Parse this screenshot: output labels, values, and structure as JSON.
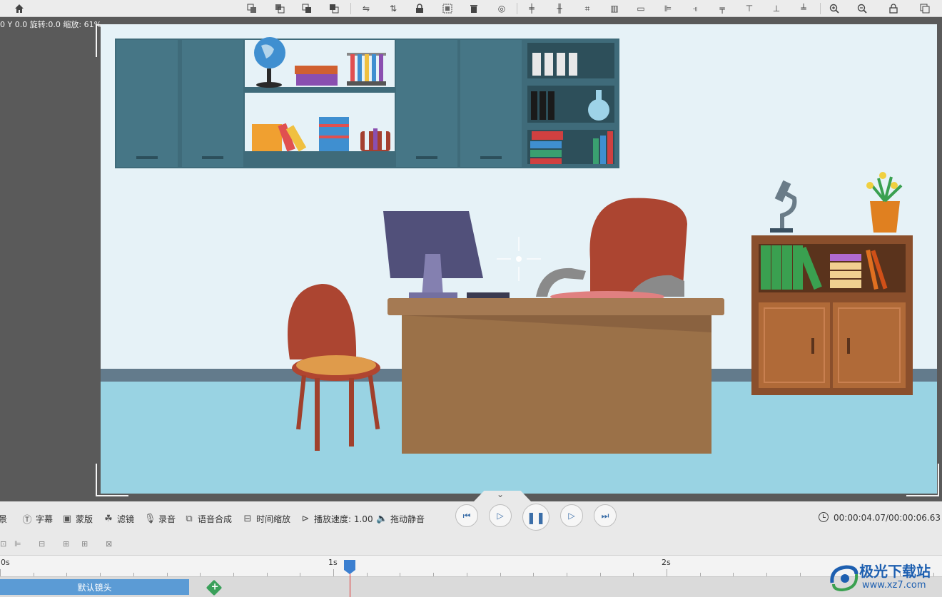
{
  "canvas": {
    "status_readout": "0 Y 0.0 旋转:0.0 缩放: 61%"
  },
  "toolbar": {
    "icons": [
      "home-icon",
      "bring-forward-icon",
      "send-backward-icon",
      "bring-front-icon",
      "send-back-icon",
      "flip-h-icon",
      "flip-v-icon",
      "lock-icon",
      "group-icon",
      "delete-icon",
      "replace-icon",
      "align-vcenter-icon",
      "distribute-h-icon",
      "fit-icon",
      "align-h-icon",
      "center-h-icon",
      "align-left-icon",
      "align-right-icon",
      "center-v-icon",
      "align-top-icon",
      "align-bottom-icon",
      "distribute-v-icon",
      "zoom-in-icon",
      "zoom-out-icon",
      "lock-layer-icon",
      "copy-icon"
    ]
  },
  "tools": {
    "foreground": "前景",
    "subtitle": "字幕",
    "mask": "蒙版",
    "filter": "滤镜",
    "record": "录音",
    "tts": "语音合成",
    "time_scale": "时间缩放",
    "speed": "播放速度: 1.00",
    "mute": "拖动静音"
  },
  "playback": {
    "time": "00:00:04.07/00:00:06.63"
  },
  "timeline": {
    "ruler_labels": [
      "0s",
      "1s",
      "2s"
    ],
    "clip_label": "默认镜头",
    "playhead_seconds": 1.05
  },
  "watermark": {
    "title": "极光下载站",
    "url": "www.xz7.com"
  },
  "colors": {
    "accent": "#3b7fd0",
    "clip": "#5b9bd5",
    "playhead_line": "#e03030"
  }
}
